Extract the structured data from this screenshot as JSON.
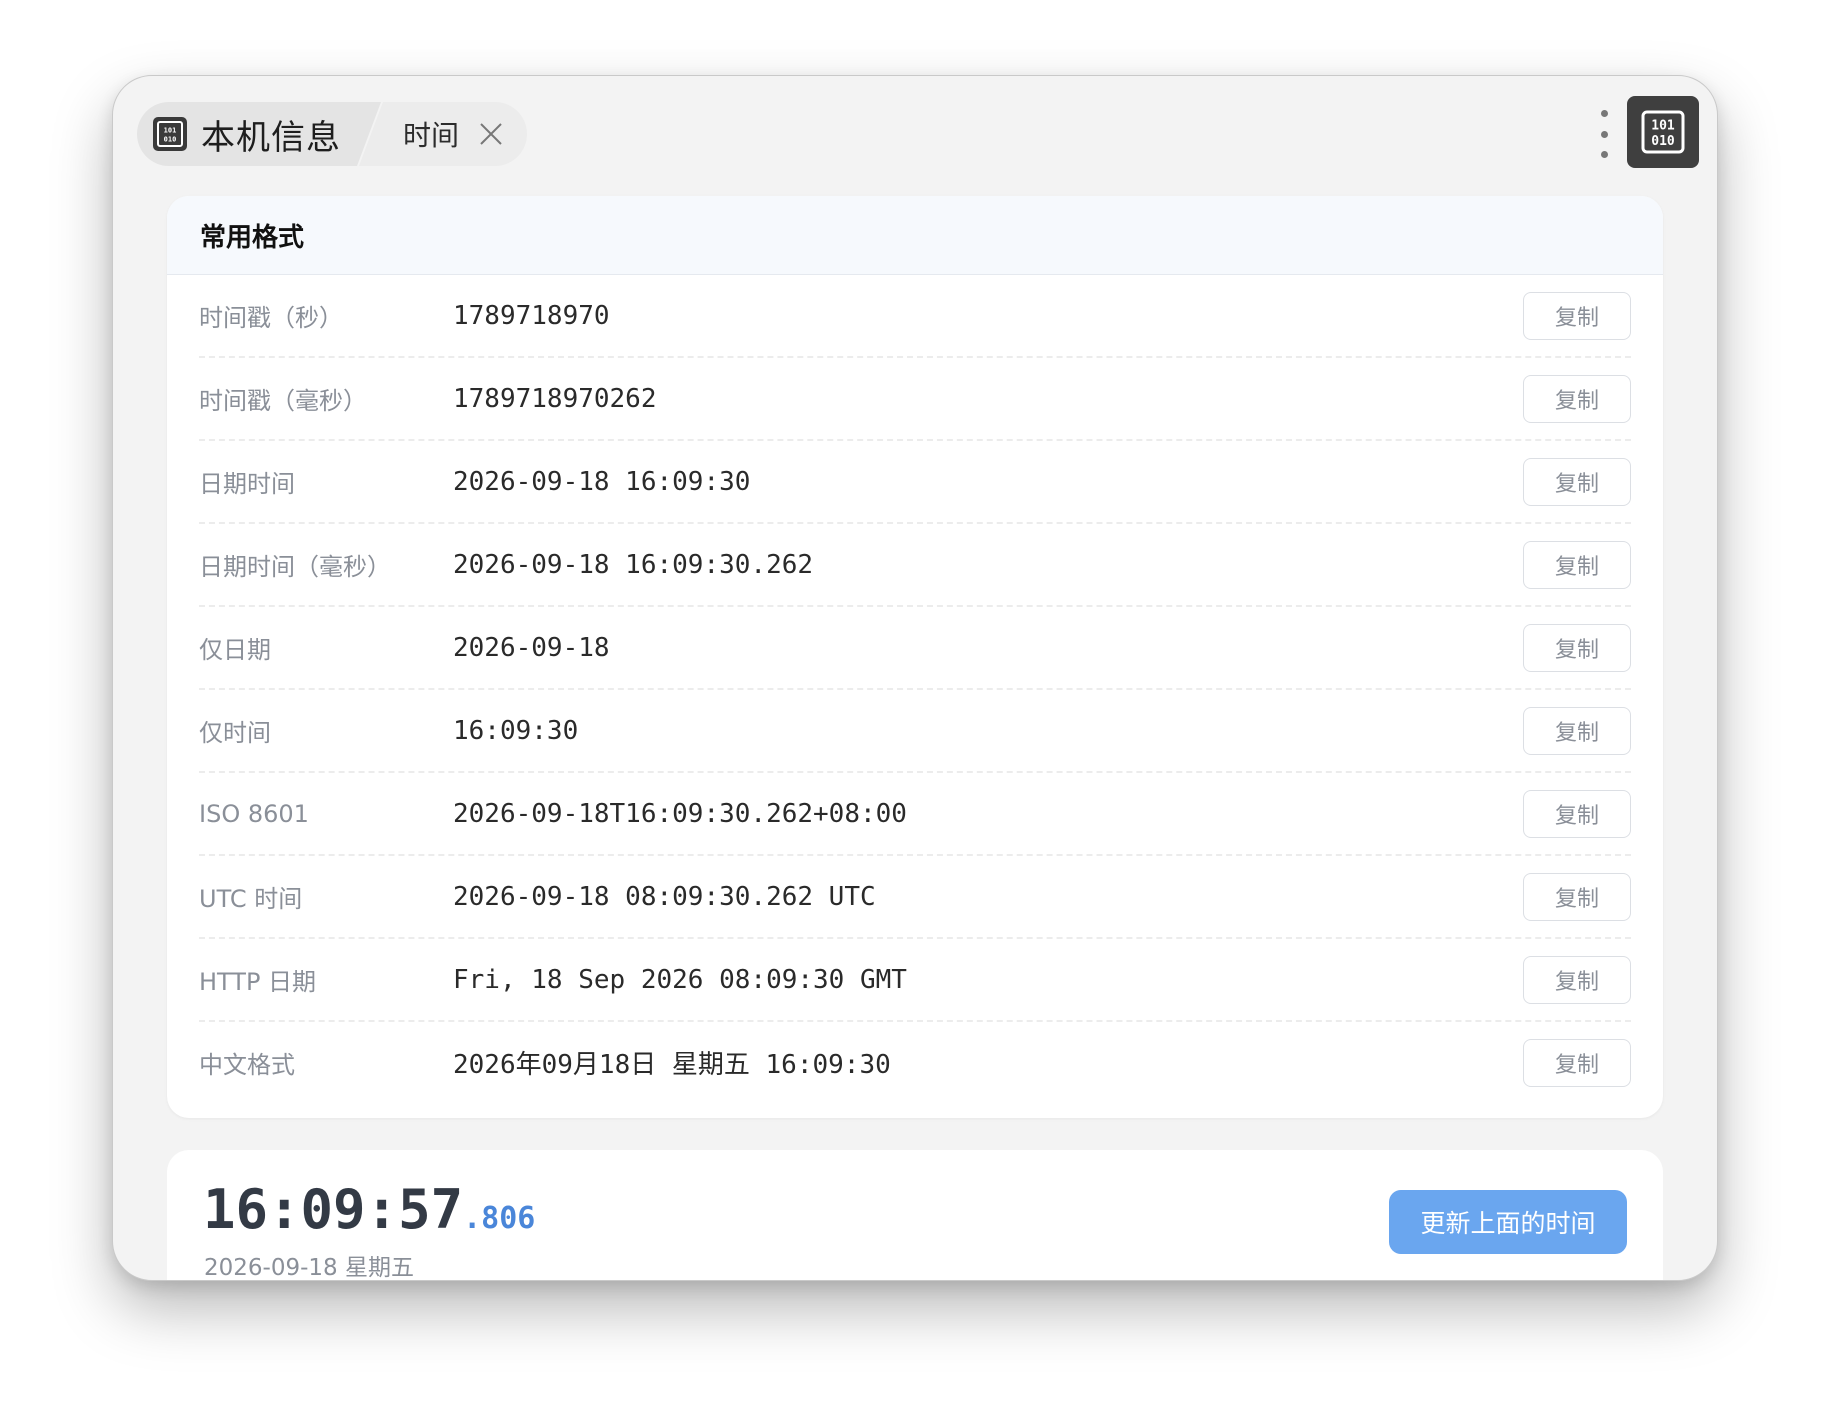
{
  "titlebar": {
    "app_label": "本机信息",
    "tab_label": "时间",
    "app_icon_name": "binary-icon",
    "close_icon_name": "close-icon",
    "menu_icon_name": "more-vertical-icon"
  },
  "formats": {
    "title": "常用格式",
    "copy_label": "复制",
    "rows": [
      {
        "label": "时间戳（秒）",
        "value": "1789718970"
      },
      {
        "label": "时间戳（毫秒）",
        "value": "1789718970262"
      },
      {
        "label": "日期时间",
        "value": "2026-09-18 16:09:30"
      },
      {
        "label": "日期时间（毫秒）",
        "value": "2026-09-18 16:09:30.262"
      },
      {
        "label": "仅日期",
        "value": "2026-09-18"
      },
      {
        "label": "仅时间",
        "value": "16:09:30"
      },
      {
        "label": "ISO 8601",
        "value": "2026-09-18T16:09:30.262+08:00"
      },
      {
        "label": "UTC 时间",
        "value": "2026-09-18 08:09:30.262 UTC"
      },
      {
        "label": "HTTP 日期",
        "value": "Fri, 18 Sep 2026 08:09:30 GMT"
      },
      {
        "label": "中文格式",
        "value": "2026年09月18日 星期五 16:09:30"
      }
    ]
  },
  "clock": {
    "time": "16:09:57",
    "ms": ".806",
    "date": "2026-09-18 星期五",
    "update_label": "更新上面的时间"
  },
  "colors": {
    "accent": "#4a86d9",
    "button": "#6aa6ef",
    "icon_bg": "#3f3f3f"
  }
}
